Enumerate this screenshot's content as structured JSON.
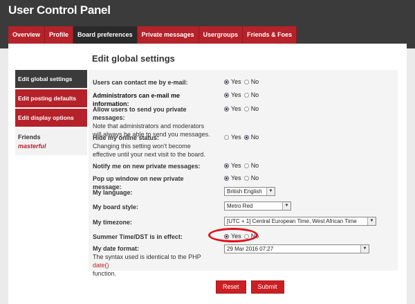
{
  "header": {
    "title": "User Control Panel"
  },
  "tabs": [
    {
      "label": "Overview"
    },
    {
      "label": "Profile"
    },
    {
      "label": "Board preferences"
    },
    {
      "label": "Private messages"
    },
    {
      "label": "Usergroups"
    },
    {
      "label": "Friends & Foes"
    }
  ],
  "section_title": "Edit global settings",
  "sidebar": {
    "items": [
      {
        "label": "Edit global settings"
      },
      {
        "label": "Edit posting defaults"
      },
      {
        "label": "Edit display options"
      }
    ],
    "friends_label": "Friends",
    "friend_name": "masterful"
  },
  "form": {
    "yes": "Yes",
    "no": "No",
    "contact_email": {
      "label": "Users can contact me by e-mail:",
      "value": "Yes"
    },
    "admin_email": {
      "label": "Administrators can e-mail me information:",
      "value": "Yes"
    },
    "allow_pm": {
      "label": "Allow users to send you private messages:",
      "note": "Note that administrators and moderators will always be able to send you messages.",
      "value": "Yes"
    },
    "hide_online": {
      "label": "Hide my online status:",
      "note": "Changing this setting won't become effective until your next visit to the board.",
      "value": "No"
    },
    "notify_pm": {
      "label": "Notify me on new private messages:",
      "value": "Yes"
    },
    "popup_pm": {
      "label": "Pop up window on new private message:",
      "value": "Yes"
    },
    "language": {
      "label": "My language:",
      "value": "British English"
    },
    "style": {
      "label": "My board style:",
      "value": "Metro Red"
    },
    "timezone": {
      "label": "My timezone:",
      "value": "[UTC + 1] Central European Time, West African Time"
    },
    "dst": {
      "label": "Summer Time/DST is in effect:",
      "value": "Yes"
    },
    "date_format": {
      "label": "My date format:",
      "note_prefix": "The syntax used is identical to the PHP",
      "note_link": "date()",
      "note_suffix": "function.",
      "value": "29 Mar 2016 07:27"
    }
  },
  "buttons": {
    "reset": "Reset",
    "submit": "Submit"
  },
  "colors": {
    "accent": "#b5222a",
    "dark": "#3b3b3b",
    "highlight_ring": "#e0111a"
  }
}
